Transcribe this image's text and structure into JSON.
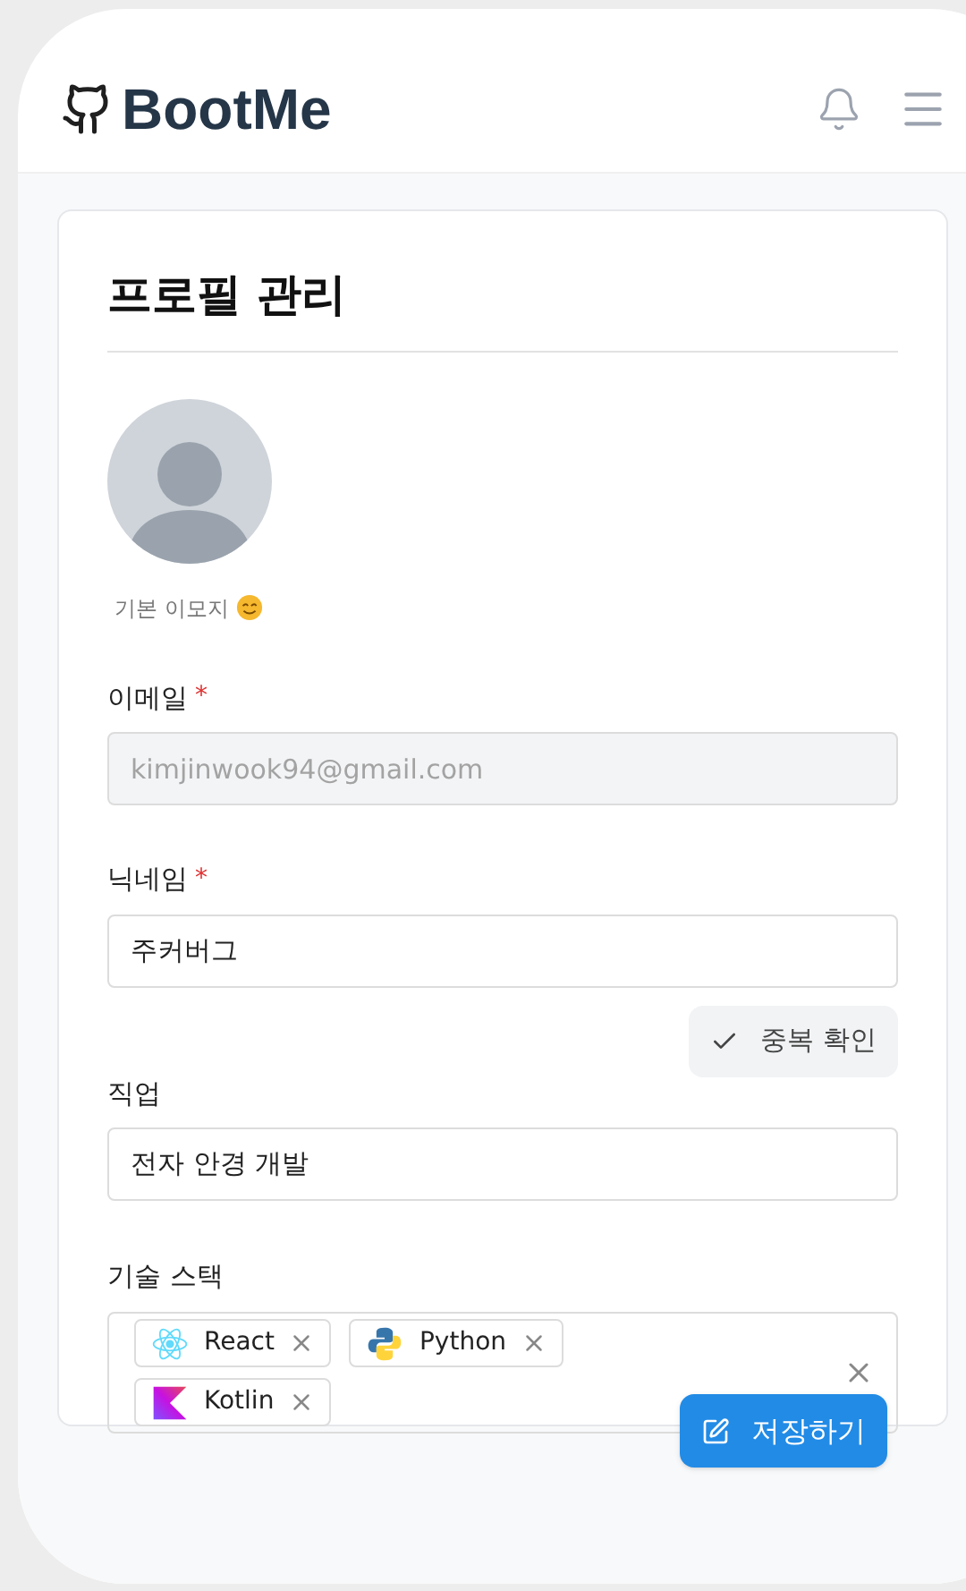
{
  "header": {
    "brand": "BootMe"
  },
  "title": "프로필 관리",
  "avatar": {
    "caption": "기본 이모지"
  },
  "fields": [
    {
      "label": "이메일",
      "required": true,
      "disabled": true,
      "value": "kimjinwook94@gmail.com"
    },
    {
      "label": "닉네임",
      "required": true,
      "disabled": false,
      "value": "주커버그"
    },
    {
      "label": "직업",
      "required": false,
      "disabled": false,
      "value": "전자 안경 개발"
    }
  ],
  "required_mark": "*",
  "duplicate_check": "중복 확인",
  "skills": {
    "label": "기술 스택",
    "items": [
      {
        "kind": "react",
        "name": "React"
      },
      {
        "kind": "python",
        "name": "Python"
      },
      {
        "kind": "kotlin",
        "name": "Kotlin"
      }
    ]
  },
  "save": "저장하기"
}
